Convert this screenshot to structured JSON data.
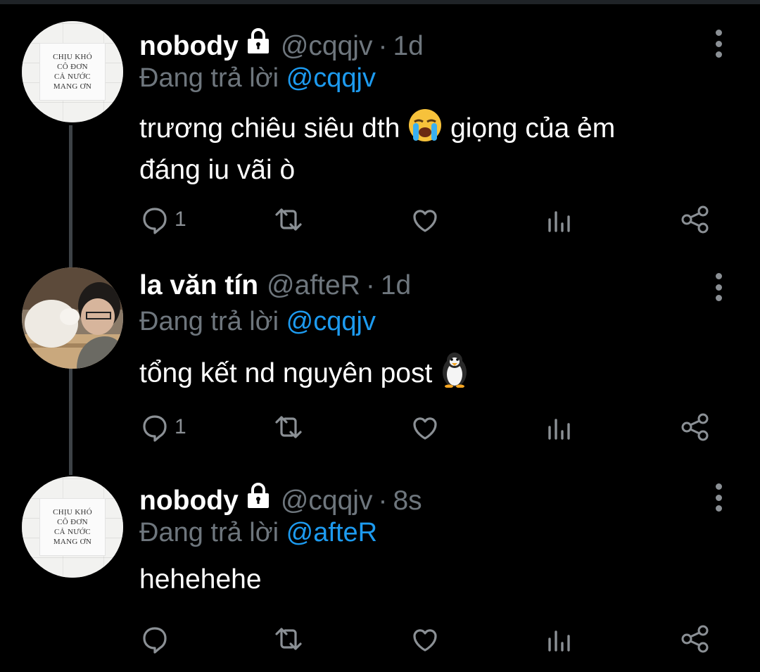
{
  "colors": {
    "background": "#000000",
    "secondary_text": "#6e767d",
    "mention": "#1d9bf0",
    "icon": "#8b9095"
  },
  "avatar_signs": {
    "nobody": [
      "CHỊU KHÓ",
      "CÔ ĐƠN",
      "CẢ NƯỚC",
      "MANG ƠN"
    ]
  },
  "tweets": [
    {
      "name": "nobody",
      "handle": "@cqqjv",
      "separator": "·",
      "time": "1d",
      "reply_prefix": "Đang trả lời ",
      "reply_to": "@cqqjv",
      "text_line1": "trương chiêu siêu dth ",
      "text_line1_after_emoji": " giọng của ẻm",
      "text_line2": "đáng iu vãi ò",
      "emoji": "loudly-crying-face",
      "reply_count": "1",
      "locked": true
    },
    {
      "name": "la văn tín",
      "handle": "@afteR",
      "separator": "·",
      "time": "1d",
      "reply_prefix": "Đang trả lời ",
      "reply_to": "@cqqjv",
      "text": "tổng kết nd nguyên post ",
      "emoji": "penguin",
      "reply_count": "1",
      "locked": false
    },
    {
      "name": "nobody",
      "handle": "@cqqjv",
      "separator": "·",
      "time": "8s",
      "reply_prefix": "Đang trả lời ",
      "reply_to": "@afteR",
      "text": "hehehehe",
      "reply_count": "",
      "locked": true
    }
  ],
  "icons": [
    "reply-icon",
    "retweet-icon",
    "like-icon",
    "analytics-icon",
    "share-icon",
    "more-icon",
    "lock-icon"
  ]
}
